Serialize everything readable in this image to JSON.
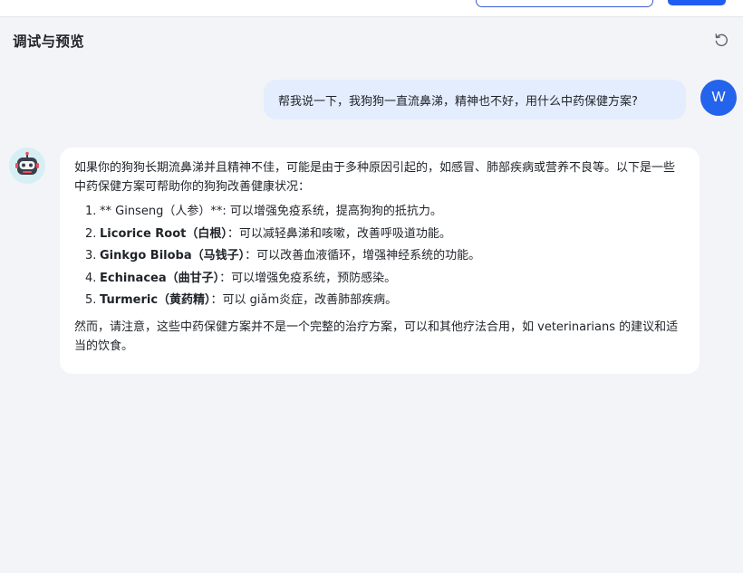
{
  "header": {
    "title": "调试与预览",
    "refresh_icon": "refresh-icon"
  },
  "chat": {
    "user": {
      "avatar_letter": "W",
      "message": "帮我说一下，我狗狗一直流鼻涕，精神也不好，用什么中药保健方案?"
    },
    "bot": {
      "avatar_icon": "robot-icon",
      "intro": "如果你的狗狗长期流鼻涕并且精神不佳，可能是由于多种原因引起的，如感冒、肺部疾病或营养不良等。以下是一些中药保健方案可帮助你的狗狗改善健康状况：",
      "items": [
        {
          "num": "1.",
          "name": "** Ginseng（人参）**",
          "desc": ": 可以增强免疫系统，提高狗狗的抵抗力。"
        },
        {
          "num": "2.",
          "name": "Licorice Root（白根）",
          "desc": "：可以减轻鼻涕和咳嗽，改善呼吸道功能。"
        },
        {
          "num": "3.",
          "name": "Ginkgo Biloba（马钱子）",
          "desc": "：可以改善血液循环，增强神经系统的功能。"
        },
        {
          "num": "4.",
          "name": "Echinacea（曲甘子）",
          "desc": "：可以增强免疫系统，预防感染。"
        },
        {
          "num": "5.",
          "name": "Turmeric（黄药精）",
          "desc": "：可以 giǎm炎症，改善肺部疾病。"
        }
      ],
      "outro": "然而，请注意，这些中药保健方案并不是一个完整的治疗方案，可以和其他疗法合用，如 veterinarians 的建议和适当的饮食。"
    }
  },
  "colors": {
    "page_bg": "#f3f4f7",
    "user_bubble": "#e3edfd",
    "user_avatar": "#2463eb",
    "bot_avatar_bg": "#d6eff4",
    "accent": "#1f5ef0"
  }
}
